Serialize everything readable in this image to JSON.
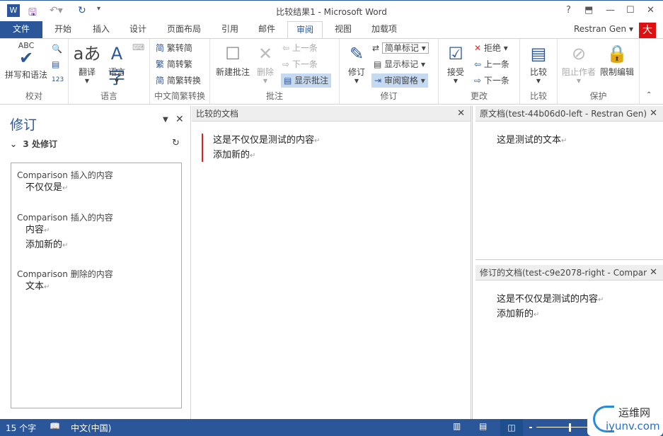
{
  "title": "比较结果1 - Microsoft Word",
  "window_controls": {
    "help": "?",
    "restore_ribbon": "⬒",
    "minimize": "—",
    "maximize": "☐",
    "close": "✕"
  },
  "tabs": [
    "文件",
    "开始",
    "插入",
    "设计",
    "页面布局",
    "引用",
    "邮件",
    "审阅",
    "视图",
    "加载项"
  ],
  "active_tab": "审阅",
  "user": "Restran Gen",
  "ribbon": {
    "proofing": {
      "label": "校对",
      "spelling": "拼写和语法",
      "abc": "ABC"
    },
    "language": {
      "label": "语言",
      "translate": "翻译",
      "language": "语言"
    },
    "chinese": {
      "label": "中文简繁转换",
      "t2s": "繁转简",
      "s2t": "简转繁",
      "convert": "简繁转换"
    },
    "comments": {
      "label": "批注",
      "new": "新建批注",
      "delete": "删除",
      "prev": "上一条",
      "next": "下一条",
      "show": "显示批注"
    },
    "tracking": {
      "label": "修订",
      "track": "修订",
      "markup": "简单标记",
      "show_markup": "显示标记",
      "pane": "审阅窗格"
    },
    "changes": {
      "label": "更改",
      "accept": "接受",
      "reject": "拒绝",
      "prev": "上一条",
      "next": "下一条"
    },
    "compare": {
      "label": "比较",
      "compare": "比较"
    },
    "protect": {
      "label": "保护",
      "block": "阻止作者",
      "restrict": "限制编辑"
    }
  },
  "revisions_pane": {
    "title": "修订",
    "count": "3 处修订",
    "items": [
      {
        "author": "Comparison",
        "action": "插入的内容",
        "lines": [
          "不仅仅是"
        ]
      },
      {
        "author": "Comparison",
        "action": "插入的内容",
        "lines": [
          "内容",
          "添加新的"
        ]
      },
      {
        "author": "Comparison",
        "action": "删除的内容",
        "lines": [
          "文本"
        ]
      }
    ]
  },
  "compared_doc": {
    "title": "比较的文档",
    "lines": [
      "这是不仅仅是测试的内容",
      "添加新的"
    ]
  },
  "original_doc": {
    "title": "原文档(test-44b06d0-left - Restran Gen)",
    "lines": [
      "这是测试的文本"
    ]
  },
  "revised_doc": {
    "title": "修订的文档(test-c9e2078-right - Compar",
    "lines": [
      "这是不仅仅是测试的内容",
      "添加新的"
    ]
  },
  "status": {
    "words": "15 个字",
    "language": "中文(中国)"
  },
  "watermark": {
    "text1": "运维网",
    "text2": "iyunv.com"
  },
  "colors": {
    "accent": "#2b579a",
    "change_bar": "#e02020"
  }
}
